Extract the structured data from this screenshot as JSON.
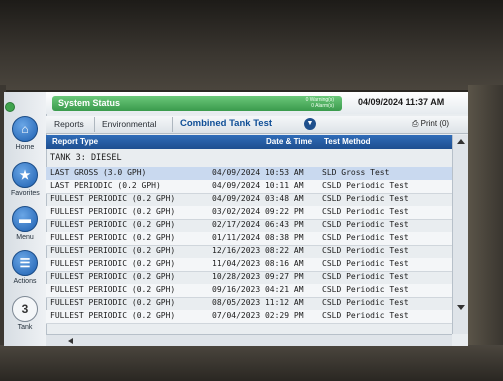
{
  "nav": {
    "home": "Home",
    "favorites": "Favorites",
    "menu": "Menu",
    "actions": "Actions",
    "tank_number": "3",
    "tank": "Tank"
  },
  "status": {
    "title": "System Status",
    "warnings": "0 Warning(s)",
    "alarms": "0 Alarm(s)",
    "datetime": "04/09/2024 11:37 AM",
    "color": "#3a9a4c"
  },
  "tabs": {
    "reports": "Reports",
    "environmental": "Environmental",
    "active": "Combined Tank Test",
    "print": "Print (0)"
  },
  "table": {
    "headers": {
      "report_type": "Report Type",
      "date_time": "Date & Time",
      "test_method": "Test Method"
    },
    "group": "TANK 3: DIESEL",
    "rows": [
      {
        "type": "LAST GROSS (3.0 GPH)",
        "datetime": "04/09/2024 10:53 AM",
        "method": "SLD Gross Test"
      },
      {
        "type": "LAST PERIODIC (0.2 GPH)",
        "datetime": "04/09/2024 10:11 AM",
        "method": "CSLD Periodic Test"
      },
      {
        "type": "FULLEST PERIODIC (0.2 GPH)",
        "datetime": "04/09/2024 03:48 AM",
        "method": "CSLD Periodic Test"
      },
      {
        "type": "FULLEST PERIODIC (0.2 GPH)",
        "datetime": "03/02/2024 09:22 PM",
        "method": "CSLD Periodic Test"
      },
      {
        "type": "FULLEST PERIODIC (0.2 GPH)",
        "datetime": "02/17/2024 06:43 PM",
        "method": "CSLD Periodic Test"
      },
      {
        "type": "FULLEST PERIODIC (0.2 GPH)",
        "datetime": "01/11/2024 08:38 PM",
        "method": "CSLD Periodic Test"
      },
      {
        "type": "FULLEST PERIODIC (0.2 GPH)",
        "datetime": "12/16/2023 08:22 AM",
        "method": "CSLD Periodic Test"
      },
      {
        "type": "FULLEST PERIODIC (0.2 GPH)",
        "datetime": "11/04/2023 08:16 AM",
        "method": "CSLD Periodic Test"
      },
      {
        "type": "FULLEST PERIODIC (0.2 GPH)",
        "datetime": "10/28/2023 09:27 PM",
        "method": "CSLD Periodic Test"
      },
      {
        "type": "FULLEST PERIODIC (0.2 GPH)",
        "datetime": "09/16/2023 04:21 AM",
        "method": "CSLD Periodic Test"
      },
      {
        "type": "FULLEST PERIODIC (0.2 GPH)",
        "datetime": "08/05/2023 11:12 AM",
        "method": "CSLD Periodic Test"
      },
      {
        "type": "FULLEST PERIODIC (0.2 GPH)",
        "datetime": "07/04/2023 02:29 PM",
        "method": "CSLD Periodic Test"
      }
    ]
  }
}
